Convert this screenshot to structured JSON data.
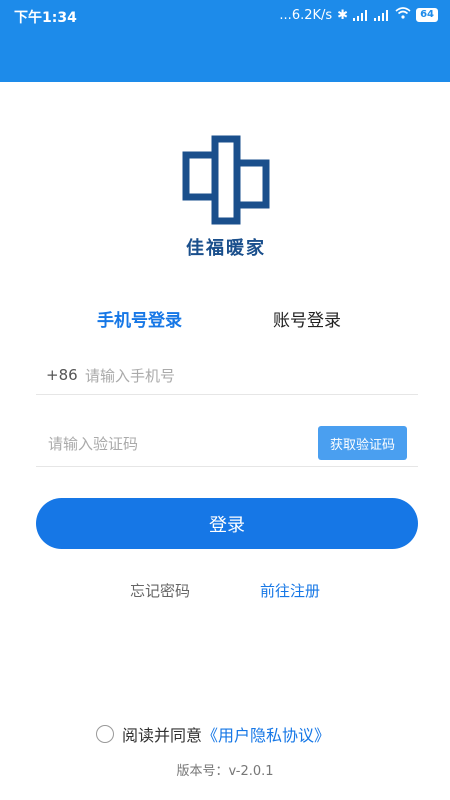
{
  "status": {
    "time": "下午1:34",
    "network_speed": "...6.2K/s",
    "battery": "64"
  },
  "brand": {
    "name": "佳福暖家"
  },
  "tabs": [
    {
      "label": "手机号登录",
      "active": true
    },
    {
      "label": "账号登录",
      "active": false
    }
  ],
  "phone": {
    "prefix": "+86",
    "placeholder": "请输入手机号"
  },
  "code": {
    "placeholder": "请输入验证码",
    "button_label": "获取验证码"
  },
  "login_button": "登录",
  "links": {
    "forgot": "忘记密码",
    "register": "前往注册"
  },
  "agreement": {
    "text": "阅读并同意",
    "link": "《用户隐私协议》",
    "checked": false
  },
  "version": "版本号：v-2.0.1",
  "colors": {
    "primary": "#1677e6",
    "status_bar": "#1d8bea",
    "logo": "#1a4f8c"
  }
}
